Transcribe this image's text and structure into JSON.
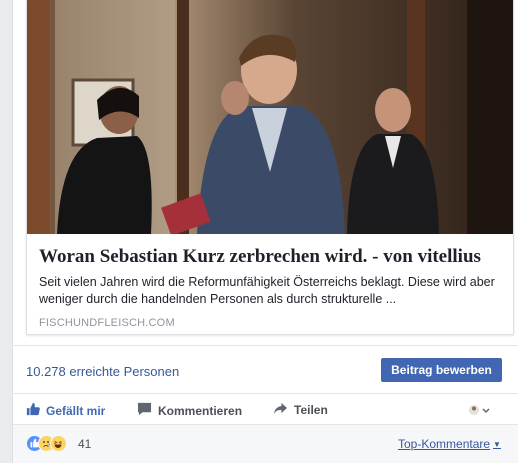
{
  "link_preview": {
    "title": "Woran Sebastian Kurz zerbrechen wird. - von vitellius",
    "description": "Seit vielen Jahren wird die Reformunfähigkeit Österreichs beklagt. Diese wird aber weniger durch die handelnden Personen als durch strukturelle ...",
    "domain": "FISCHUNDFLEISCH.COM"
  },
  "reach": {
    "text": "10.278 erreichte Personen",
    "boost_label": "Beitrag bewerben"
  },
  "actions": {
    "like_label": "Gefällt mir",
    "comment_label": "Kommentieren",
    "share_label": "Teilen"
  },
  "reactions": {
    "count": "41",
    "top_comments_label": "Top-Kommentare"
  },
  "colors": {
    "accent": "#4267b2",
    "link": "#365899",
    "background": "#e9ebee"
  },
  "icons": [
    "like-icon",
    "comment-icon",
    "share-icon",
    "viewer-switch-icon",
    "like-reaction-icon",
    "sad-reaction-icon",
    "haha-reaction-icon",
    "caret-down-icon"
  ]
}
